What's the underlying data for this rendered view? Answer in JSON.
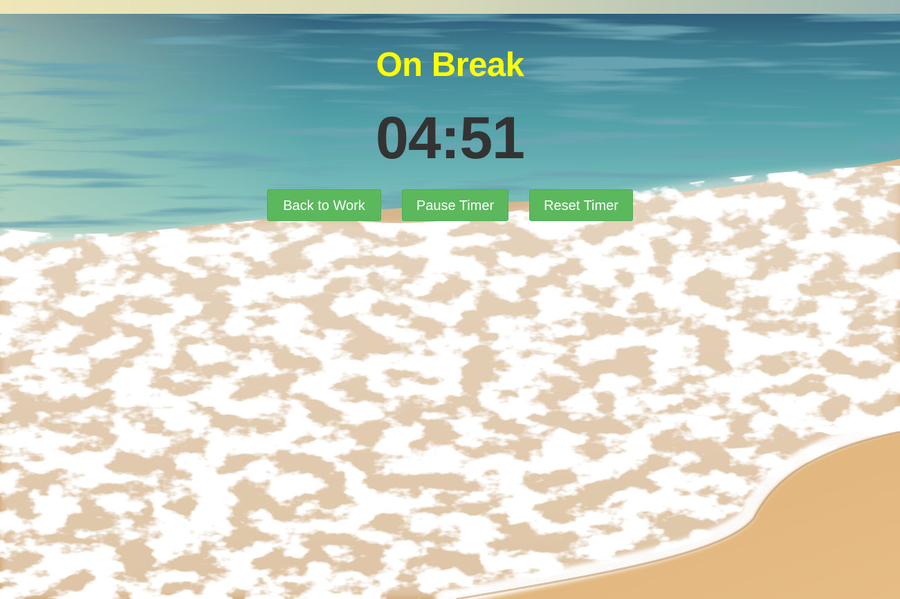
{
  "status": {
    "title": "On Break",
    "title_color": "#ffff00"
  },
  "timer": {
    "display": "04:51",
    "color": "#333333"
  },
  "buttons": {
    "back_to_work": "Back to Work",
    "pause_timer": "Pause Timer",
    "reset_timer": "Reset Timer",
    "color": "#5cb85c"
  },
  "background": {
    "scene": "beach-waves-image"
  }
}
